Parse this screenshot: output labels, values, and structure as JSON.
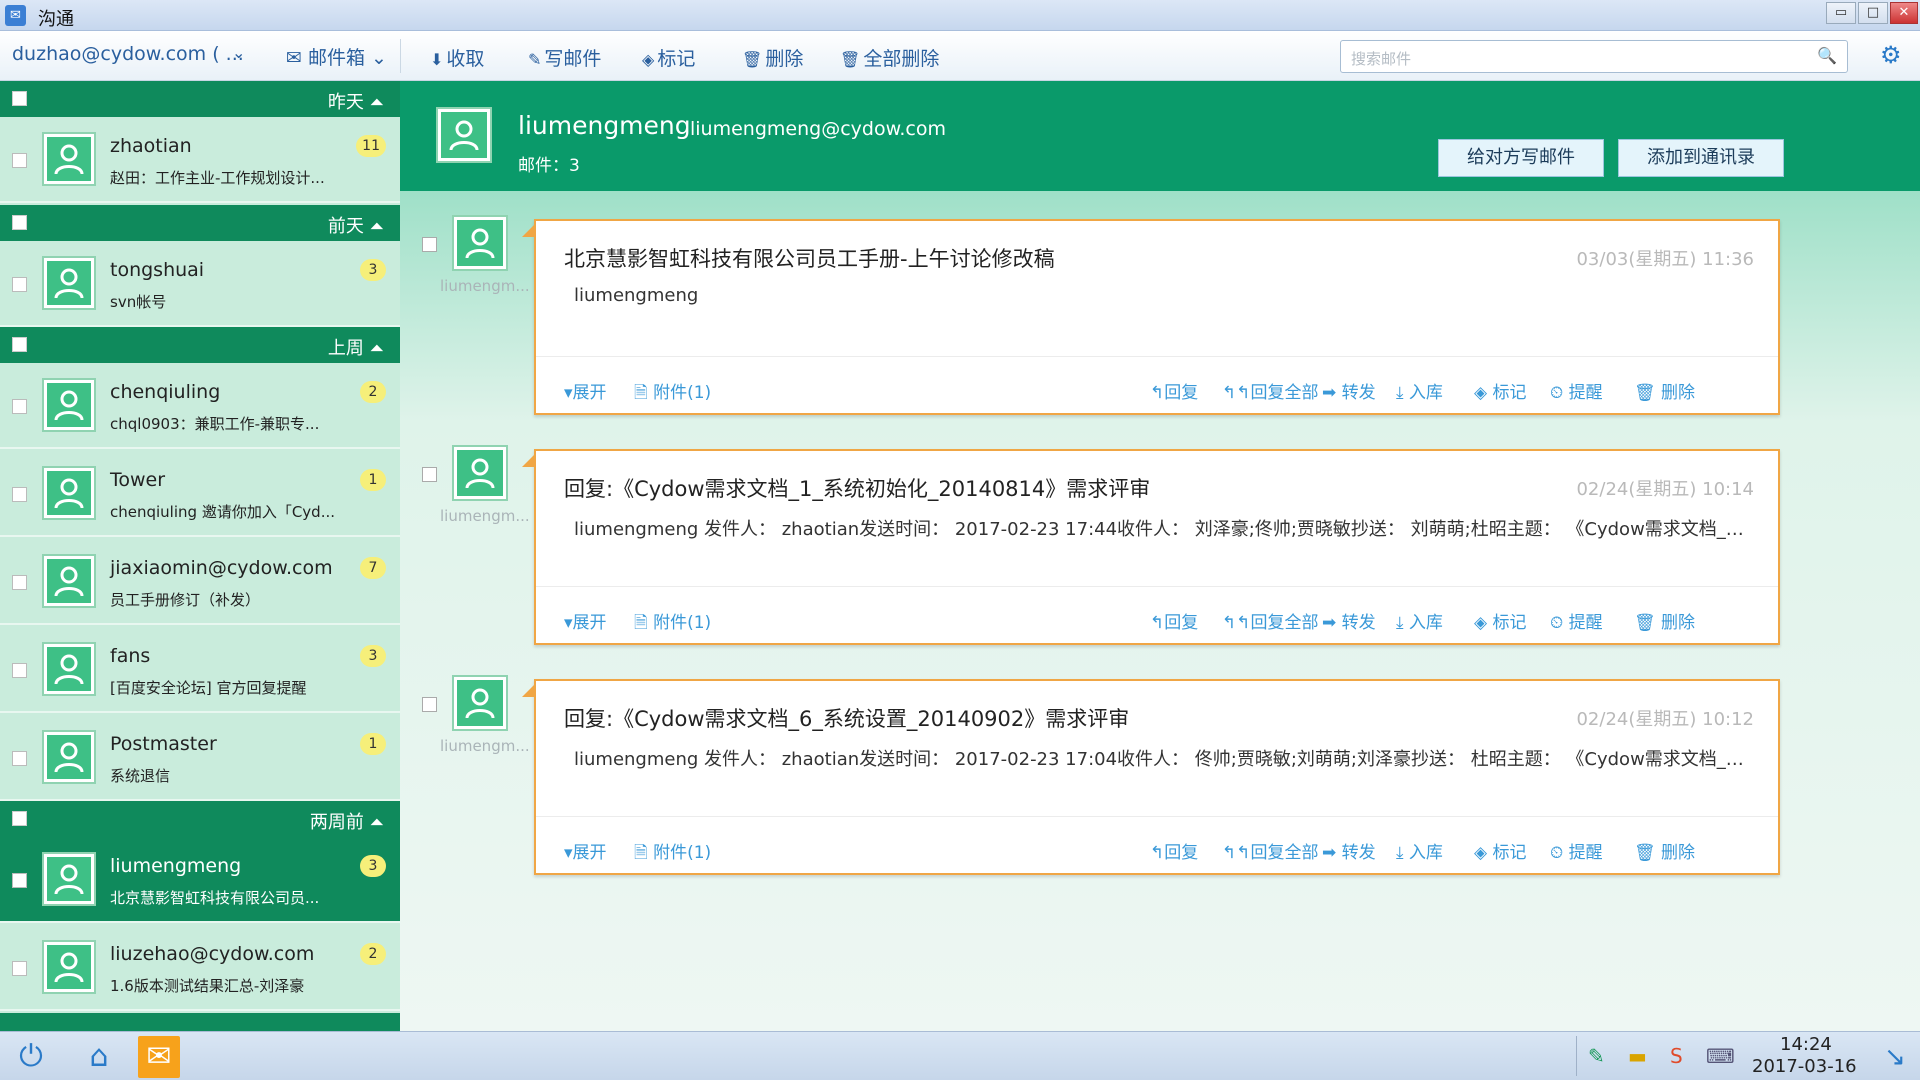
{
  "window": {
    "title": "沟通",
    "min": "▭",
    "max": "□",
    "close": "✕"
  },
  "toolbar": {
    "account": "duzhao@cydow.com ( ...",
    "mailbox": "邮件箱",
    "receive": "收取",
    "compose": "写邮件",
    "mark": "标记",
    "delete": "删除",
    "delete_all": "全部删除",
    "search_placeholder": "搜索邮件"
  },
  "sidebar": {
    "groups": [
      "昨天",
      "前天",
      "上周",
      "两周前"
    ],
    "conversations": [
      {
        "name": "zhaotian",
        "snippet": "赵田：工作主业-工作规划设计...",
        "count": "11"
      },
      {
        "name": "tongshuai",
        "snippet": "svn帐号",
        "count": "3"
      },
      {
        "name": "chenqiuling",
        "snippet": "chql0903：兼职工作-兼职专...",
        "count": "2"
      },
      {
        "name": "Tower",
        "snippet": "chenqiuling 邀请你加入「Cyd...",
        "count": "1"
      },
      {
        "name": "jiaxiaomin@cydow.com",
        "snippet": "员工手册修订（补发）",
        "count": "7"
      },
      {
        "name": "fans",
        "snippet": "[百度安全论坛] 官方回复提醒",
        "count": "3"
      },
      {
        "name": "Postmaster",
        "snippet": "系统退信",
        "count": "1"
      },
      {
        "name": "liumengmeng",
        "snippet": "北京慧影智虹科技有限公司员...",
        "count": "3"
      },
      {
        "name": "liuzehao@cydow.com",
        "snippet": "1.6版本测试结果汇总-刘泽豪",
        "count": "2"
      }
    ]
  },
  "header": {
    "name": "liumengmeng",
    "email": "liumengmeng@cydow.com",
    "count_label": "邮件：3",
    "write_btn": "给对方写邮件",
    "add_btn": "添加到通讯录"
  },
  "mail_sender_label": "liumengm...",
  "actions": {
    "expand": "展开",
    "reply": "回复",
    "reply_all": "回复全部",
    "forward": "转发",
    "archive": "入库",
    "mark": "标记",
    "remind": "提醒",
    "delete": "删除"
  },
  "mails": [
    {
      "subject": "北京慧影智虹科技有限公司员工手册-上午讨论修改稿",
      "date": "03/03(星期五) 11:36",
      "body": "liumengmeng",
      "attachment": "附件(1)"
    },
    {
      "subject": "回复:《Cydow需求文档_1_系统初始化_20140814》需求评审",
      "date": "02/24(星期五) 10:14",
      "body": "liumengmeng 发件人： zhaotian发送时间： 2017-02-23 17:44收件人： 刘泽豪;佟帅;贾晓敏抄送： 刘萌萌;杜昭主题： 《Cydow需求文档_1_...",
      "attachment": "附件(1)"
    },
    {
      "subject": "回复:《Cydow需求文档_6_系统设置_20140902》需求评审",
      "date": "02/24(星期五) 10:12",
      "body": "liumengmeng 发件人： zhaotian发送时间： 2017-02-23 17:04收件人： 佟帅;贾晓敏;刘萌萌;刘泽豪抄送： 杜昭主题： 《Cydow需求文档_6_...",
      "attachment": "附件(1)"
    }
  ],
  "taskbar": {
    "time": "14:24",
    "date": "2017-03-16"
  },
  "colors": {
    "primary_green": "#0f8a5c",
    "list_bg": "#c9ecdc",
    "mail_border": "#f0a645",
    "link_blue": "#3a99d8",
    "badge": "#f6ef7a"
  }
}
